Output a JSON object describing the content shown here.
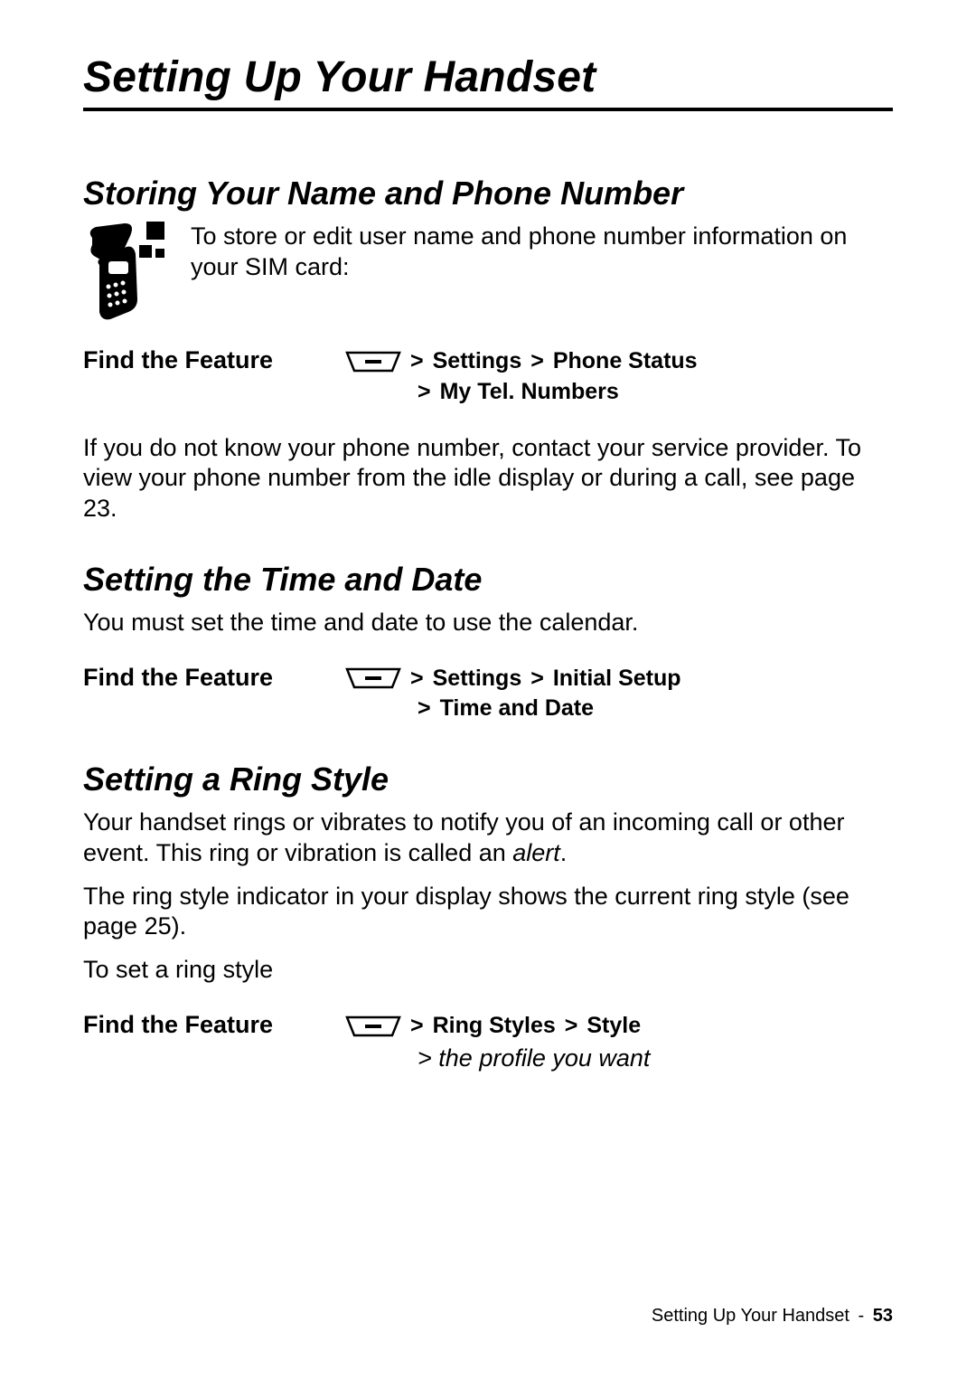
{
  "chapter": {
    "title": "Setting Up Your Handset"
  },
  "sections": {
    "storing": {
      "title": "Storing Your Name and Phone Number",
      "intro": "To store or edit user name and phone number information on your SIM card:",
      "find_label": "Find the Feature",
      "nav1_a": "Settings",
      "nav1_b": "Phone Status",
      "nav2": "My Tel. Numbers",
      "note": "If you do not know your phone number, contact your service provider. To view your phone number from the idle display or during a call, see page 23."
    },
    "timedate": {
      "title": "Setting the Time and Date",
      "intro": "You must set the time and date to use the calendar.",
      "find_label": "Find the Feature",
      "nav1_a": "Settings",
      "nav1_b": "Initial Setup",
      "nav2": "Time and Date"
    },
    "ringstyle": {
      "title": "Setting a Ring Style",
      "intro1_a": "Your handset rings or vibrates to notify you of an incoming call or other event. This ring or vibration is called an ",
      "intro1_b": "alert",
      "intro1_c": ".",
      "intro2": "The ring style indicator in your display shows the current ring style (see page 25).",
      "intro3": "To set a ring style",
      "find_label": "Find the Feature",
      "nav1_a": "Ring Styles",
      "nav1_b": "Style",
      "nav2_prefix": "> ",
      "nav2_ital": "the profile you want"
    }
  },
  "glyphs": {
    "gt": ">"
  },
  "footer": {
    "title": "Setting Up Your Handset",
    "sep": "-",
    "page": "53"
  }
}
